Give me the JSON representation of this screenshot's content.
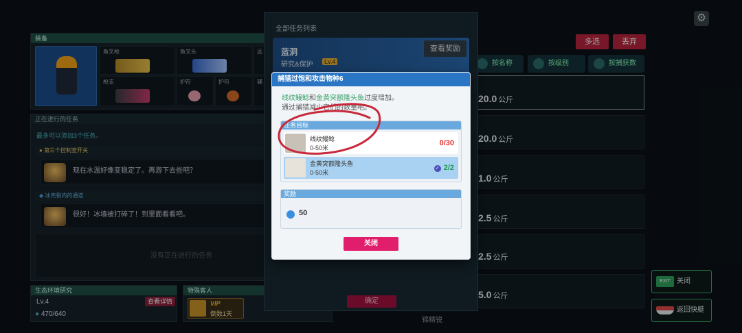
{
  "left": {
    "equipment": {
      "title": "装备",
      "slots": [
        {
          "label": "鱼叉枪"
        },
        {
          "label": "鱼叉头"
        },
        {
          "label": "远"
        },
        {
          "label": "枪支"
        },
        {
          "label": "护符"
        },
        {
          "label": "护符"
        },
        {
          "label": "辅"
        }
      ]
    },
    "quests": {
      "title": "正在进行的任务",
      "hint": "最多可以添加3个任务。",
      "items": [
        {
          "tag": "第三个控制室开关",
          "message": "现在水温好像变稳定了。再游下去些吧？"
        },
        {
          "tag": "冰壳裂内的通道",
          "message": "很好！冰墙被打碎了！到里面看看吧。"
        }
      ],
      "empty": "没有正在进行的任务"
    },
    "eco": {
      "title": "生态环境研究",
      "level": "Lv.4",
      "btn": "查看详情",
      "progress": "470/640"
    },
    "guest": {
      "title": "特殊客人",
      "vip": "VIP",
      "days": "倒数1天"
    }
  },
  "list_panel": {
    "title": "全部任务列表",
    "card": {
      "name": "蓝洞",
      "sub": "研究&保护",
      "badge": "Lv.4",
      "reward_btn": "查看奖励"
    },
    "confirm": "确定"
  },
  "right": {
    "top_buttons": {
      "multi": "多选",
      "discard": "丢弃"
    },
    "sort": [
      "按名称",
      "按级别",
      "按捕获数"
    ],
    "weights": [
      "20.0",
      "20.0",
      "1.0",
      "2.5",
      "2.5",
      "5.0"
    ],
    "unit": "公斤",
    "exit": "关闭",
    "return": "返回快艇",
    "bottom_hint": "锦精锐"
  },
  "modal": {
    "title": "捕猎过饱和攻击物种6",
    "desc_fish1": "线纹鳗鲶",
    "desc_and": "和",
    "desc_fish2": "金黄突额隆头鱼",
    "desc_rest": "过度增加。",
    "desc_line2": "通过捕猎减少它们的数量吧。",
    "targets_title": "任务目标",
    "targets": [
      {
        "name": "线纹鳗鲶",
        "range": "0-50米",
        "count": "0/30",
        "done": false
      },
      {
        "name": "金黄突额隆头鱼",
        "range": "0-50米",
        "count": "2/2",
        "done": true
      }
    ],
    "reward_title": "奖励",
    "reward_value": "50",
    "close": "关闭"
  },
  "colors": {
    "accent": "#2a76c4",
    "close": "#e11e6b",
    "annotation": "#c8283a"
  }
}
